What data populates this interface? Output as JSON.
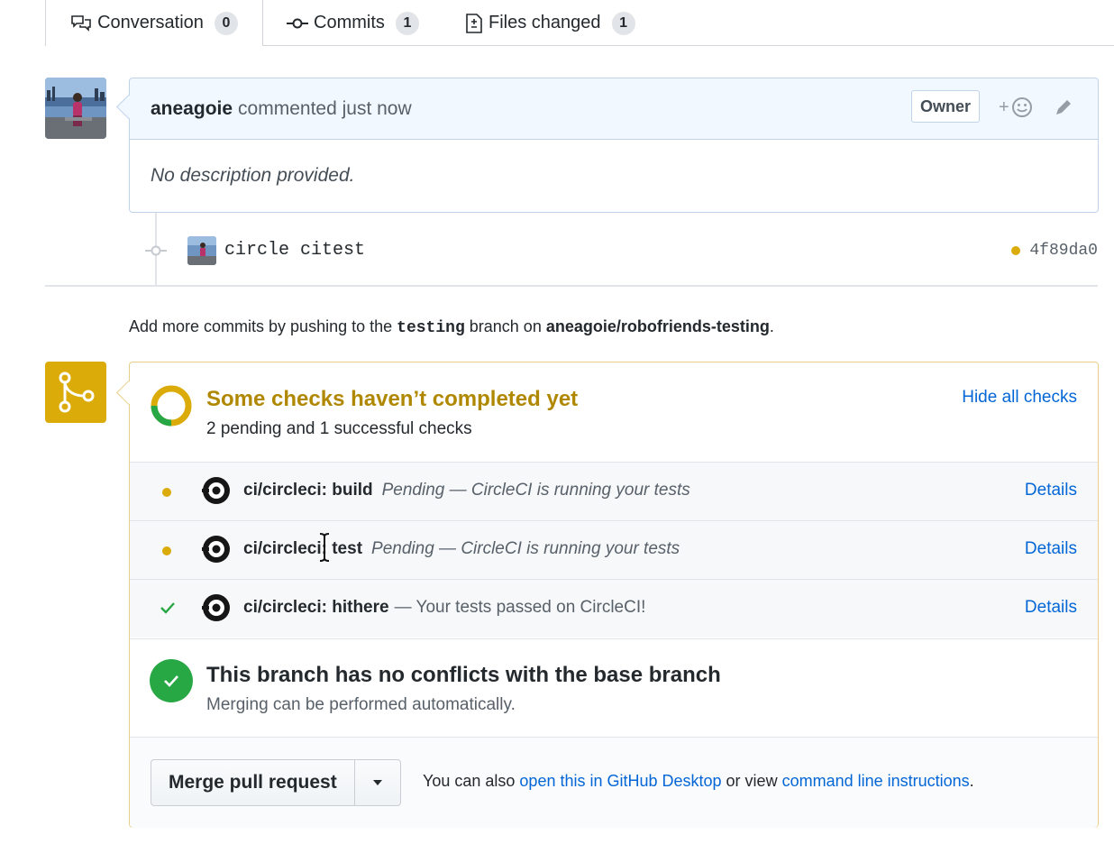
{
  "tabs": [
    {
      "label": "Conversation",
      "count": "0",
      "icon": "comment-discussion-icon",
      "selected": true
    },
    {
      "label": "Commits",
      "count": "1",
      "icon": "git-commit-icon"
    },
    {
      "label": "Files changed",
      "count": "1",
      "icon": "file-diff-icon"
    }
  ],
  "comment": {
    "author": "aneagoie",
    "action": "commented just now",
    "badge": "Owner",
    "reaction_label": "+",
    "body": "No description provided."
  },
  "commit": {
    "message": "circle citest",
    "sha": "4f89da0",
    "status_color": "#dbab09"
  },
  "push_note": {
    "prefix": "Add more commits by pushing to the ",
    "branch": "testing",
    "middle": " branch on ",
    "repo": "aneagoie/robofriends-testing",
    "suffix": "."
  },
  "checks": {
    "title": "Some checks haven’t completed yet",
    "subtitle": "2 pending and 1 successful checks",
    "toggle": "Hide all checks",
    "items": [
      {
        "name": "ci/circleci: build",
        "description": "Pending — CircleCI is running your tests",
        "status": "pending",
        "details": "Details"
      },
      {
        "name": "ci/circleci: test",
        "description": "Pending — CircleCI is running your tests",
        "status": "pending",
        "details": "Details"
      },
      {
        "name": "ci/circleci: hithere",
        "description": "— Your tests passed on CircleCI!",
        "status": "success",
        "details": "Details"
      }
    ]
  },
  "conflict": {
    "title": "This branch has no conflicts with the base branch",
    "subtitle": "Merging can be performed automatically."
  },
  "merge": {
    "button": "Merge pull request",
    "text_prefix": "You can also ",
    "desktop_link": "open this in GitHub Desktop",
    "text_middle": " or view ",
    "cli_link": "command line instructions",
    "text_suffix": "."
  },
  "colors": {
    "pending": "#dbab09",
    "success": "#28a745",
    "link": "#0366d6",
    "comment_header": "#f1f8ff"
  }
}
